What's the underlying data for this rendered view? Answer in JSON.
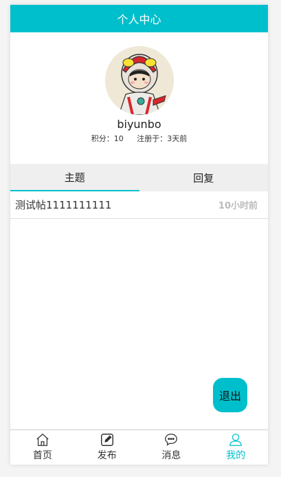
{
  "header": {
    "title": "个人中心"
  },
  "profile": {
    "username": "biyunbo",
    "points": "积分：10",
    "registered": "注册于：3天前"
  },
  "tabs": [
    {
      "label": "主题",
      "active": true
    },
    {
      "label": "回复",
      "active": false
    }
  ],
  "topics": [
    {
      "title": "测试帖1111111111",
      "time": "10小时前"
    }
  ],
  "logout": {
    "label": "退出"
  },
  "nav": [
    {
      "label": "首页",
      "icon": "home-icon",
      "active": false
    },
    {
      "label": "发布",
      "icon": "edit-icon",
      "active": false
    },
    {
      "label": "消息",
      "icon": "message-icon",
      "active": false
    },
    {
      "label": "我的",
      "icon": "user-icon",
      "active": true
    }
  ],
  "colors": {
    "accent": "#00bfcc"
  }
}
